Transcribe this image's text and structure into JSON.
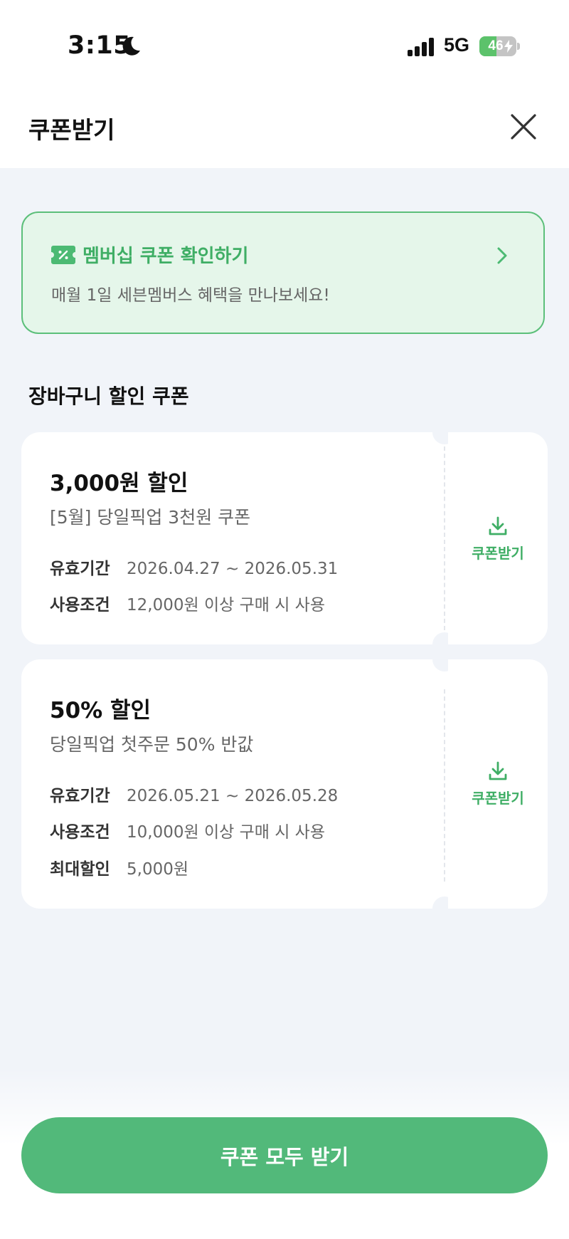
{
  "status_bar": {
    "time": "3:15",
    "network": "5G",
    "battery": "46",
    "battery_level": 0.46,
    "icons": [
      "moon-icon",
      "signal-icon",
      "battery-icon",
      "bolt-icon"
    ]
  },
  "header": {
    "title": "쿠폰받기",
    "close_icon": "close-icon"
  },
  "membership_banner": {
    "icon": "coupon-ticket-icon",
    "title": "멤버십 쿠폰 확인하기",
    "subtitle": "매월 1일 세븐멤버스 혜택을 만나보세요!",
    "chevron_icon": "chevron-right-icon"
  },
  "section": {
    "title": "장바구니 할인 쿠폰"
  },
  "coupons": [
    {
      "amount": "3,000원 할인",
      "name": "[5월] 당일픽업 3천원 쿠폰",
      "details": [
        {
          "label": "유효기간",
          "value": "2026.04.27 ~ 2026.05.31"
        },
        {
          "label": "사용조건",
          "value": "12,000원 이상 구매 시 사용"
        }
      ],
      "download_label": "쿠폰받기",
      "download_icon": "download-icon"
    },
    {
      "amount": "50% 할인",
      "name": "당일픽업 첫주문 50% 반값",
      "details": [
        {
          "label": "유효기간",
          "value": "2026.05.21 ~ 2026.05.28"
        },
        {
          "label": "사용조건",
          "value": "10,000원 이상 구매 시 사용"
        },
        {
          "label": "최대할인",
          "value": "5,000원"
        }
      ],
      "download_label": "쿠폰받기",
      "download_icon": "download-icon"
    }
  ],
  "cta": {
    "label": "쿠폰 모두 받기"
  },
  "colors": {
    "accent_green": "#52b97a",
    "text_green": "#3fae65",
    "banner_bg": "#e5f6ea",
    "page_bg": "#f1f4f9"
  }
}
